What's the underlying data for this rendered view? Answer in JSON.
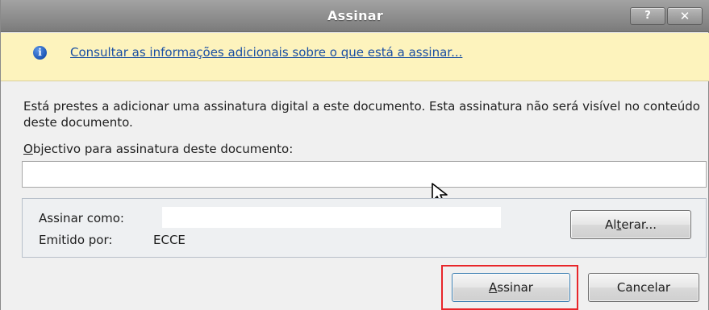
{
  "window": {
    "title": "Assinar",
    "help_label": "?",
    "close_label": "✕"
  },
  "infobar": {
    "icon": "info-icon",
    "icon_glyph": "i",
    "link_text": "Consultar as informações adicionais sobre o que está a assinar..."
  },
  "body": {
    "description": "Está prestes a adicionar uma assinatura digital a este documento. Esta assinatura não será visível no conteúdo deste documento.",
    "purpose_label_accel": "O",
    "purpose_label_rest": "bjectivo para assinatura deste documento:",
    "purpose_value": ""
  },
  "signer": {
    "sign_as_label": "Assinar como:",
    "sign_as_value": "",
    "issued_by_label": "Emitido por:",
    "issued_by_value": "ECCE",
    "change_button_pre": "Al",
    "change_button_accel": "t",
    "change_button_post": "erar..."
  },
  "actions": {
    "sign_accel": "A",
    "sign_rest": "ssinar",
    "cancel_label": "Cancelar"
  },
  "colors": {
    "infobar_bg": "#fdf3bd",
    "link": "#1a4fa3",
    "highlight": "#e8262a"
  }
}
